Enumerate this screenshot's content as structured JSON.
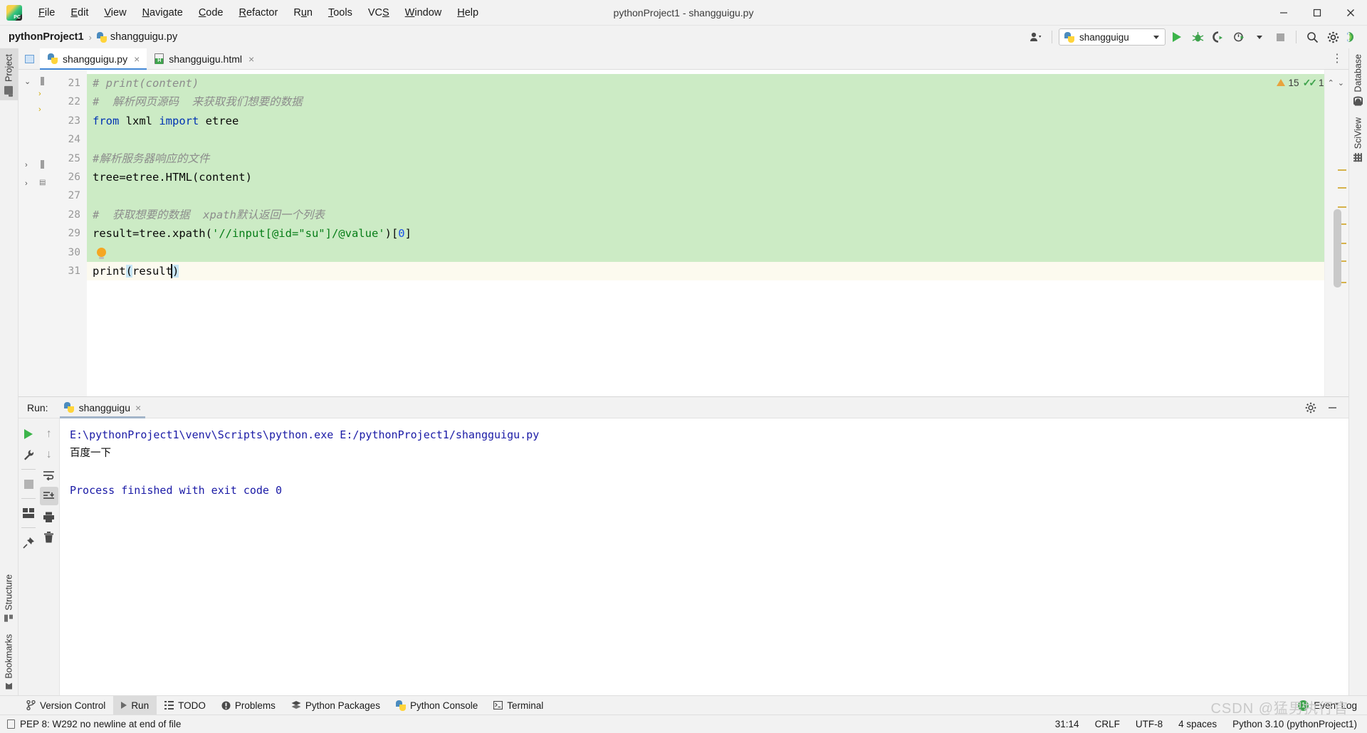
{
  "window": {
    "title": "pythonProject1 - shangguigu.py",
    "controls": {
      "minimize": "—",
      "maximize": "▢",
      "close": "✕"
    }
  },
  "menubar": [
    {
      "label": "File"
    },
    {
      "label": "Edit"
    },
    {
      "label": "View"
    },
    {
      "label": "Navigate"
    },
    {
      "label": "Code"
    },
    {
      "label": "Refactor"
    },
    {
      "label": "Run"
    },
    {
      "label": "Tools"
    },
    {
      "label": "VCS"
    },
    {
      "label": "Window"
    },
    {
      "label": "Help"
    }
  ],
  "breadcrumb": {
    "project": "pythonProject1",
    "separator": "›",
    "file": "shangguigu.py"
  },
  "toolbar": {
    "run_config": "shangguigu",
    "icons": [
      "user-account-icon",
      "run-icon",
      "debug-icon",
      "run-coverage-icon",
      "profile-icon",
      "stop-icon",
      "search-icon",
      "settings-icon",
      "updates-icon"
    ]
  },
  "left_strip": {
    "top": [
      {
        "label": "Project",
        "icon": "folder-icon",
        "active": true
      }
    ],
    "bottom": [
      {
        "label": "Structure",
        "icon": "structure-icon"
      },
      {
        "label": "Bookmarks",
        "icon": "bookmark-icon"
      }
    ]
  },
  "right_strip": [
    {
      "label": "Database",
      "icon": "database-icon"
    },
    {
      "label": "SciView",
      "icon": "grid-icon"
    }
  ],
  "editor": {
    "tabs": [
      {
        "label": "shangguigu.py",
        "icon": "python-file-icon",
        "active": true,
        "close": "×"
      },
      {
        "label": "shangguigu.html",
        "icon": "html-file-icon",
        "active": false,
        "close": "×"
      }
    ],
    "inspection": {
      "warning_count": "15",
      "check_count": "1",
      "up": "⌃",
      "down": "⌄"
    },
    "lines": [
      {
        "num": "21",
        "tokens": [
          {
            "t": "# print(content)",
            "c": "cm"
          }
        ],
        "hl": "green"
      },
      {
        "num": "22",
        "tokens": [
          {
            "t": "#  解析网页源码  来获取我们想要的数据",
            "c": "cm"
          }
        ],
        "hl": "green"
      },
      {
        "num": "23",
        "tokens": [
          {
            "t": "from",
            "c": "kw"
          },
          {
            "t": " lxml ",
            "c": "plain"
          },
          {
            "t": "import",
            "c": "kw"
          },
          {
            "t": " etree",
            "c": "plain"
          }
        ],
        "hl": "green"
      },
      {
        "num": "24",
        "tokens": [],
        "hl": "green"
      },
      {
        "num": "25",
        "tokens": [
          {
            "t": "#解析服务器响应的文件",
            "c": "cm"
          }
        ],
        "hl": "green"
      },
      {
        "num": "26",
        "tokens": [
          {
            "t": "tree=etree.HTML(content)",
            "c": "plain"
          }
        ],
        "hl": "green"
      },
      {
        "num": "27",
        "tokens": [],
        "hl": "green"
      },
      {
        "num": "28",
        "tokens": [
          {
            "t": "#  获取想要的数据  xpath默认返回一个列表",
            "c": "cm"
          }
        ],
        "hl": "green"
      },
      {
        "num": "29",
        "tokens": [
          {
            "t": "result=tree.xpath(",
            "c": "plain"
          },
          {
            "t": "'//input[@id=\"su\"]/@value'",
            "c": "str"
          },
          {
            "t": ")[",
            "c": "plain"
          },
          {
            "t": "0",
            "c": "num"
          },
          {
            "t": "]",
            "c": "plain"
          }
        ],
        "hl": "green"
      },
      {
        "num": "30",
        "tokens": [],
        "hl": "green",
        "bulb": true
      },
      {
        "num": "31",
        "tokens": [
          {
            "t": "print",
            "c": "plain"
          },
          {
            "t": "(",
            "c": "sel"
          },
          {
            "t": "result",
            "c": "plain"
          },
          {
            "t": ")",
            "c": "sel"
          }
        ],
        "hl": "cur",
        "caret": true
      }
    ]
  },
  "run_panel": {
    "label": "Run:",
    "tab": "shangguigu",
    "tab_close": "×",
    "header_icons": [
      "settings-icon",
      "minimize-icon"
    ],
    "side_buttons_left": [
      "rerun-icon",
      "settings-wrench-icon",
      "stop-icon",
      "layout-icon",
      "pin-icon"
    ],
    "side_buttons_right": [
      "up-arrow-icon",
      "down-arrow-icon",
      "soft-wrap-icon",
      "scroll-to-end-icon",
      "print-icon",
      "trash-icon"
    ],
    "console_lines": [
      {
        "text": "E:\\pythonProject1\\venv\\Scripts\\python.exe E:/pythonProject1/shangguigu.py",
        "style": "path"
      },
      {
        "text": "百度一下",
        "style": "out"
      },
      {
        "text": "",
        "style": "out"
      },
      {
        "text": "Process finished with exit code 0",
        "style": "fin"
      }
    ]
  },
  "toolwindow_bar": {
    "items": [
      {
        "label": "Version Control",
        "icon": "branch-icon",
        "active": false
      },
      {
        "label": "Run",
        "icon": "run-icon",
        "active": true
      },
      {
        "label": "TODO",
        "icon": "list-icon",
        "active": false
      },
      {
        "label": "Problems",
        "icon": "warning-circle-icon",
        "active": false
      },
      {
        "label": "Python Packages",
        "icon": "packages-icon",
        "active": false
      },
      {
        "label": "Python Console",
        "icon": "python-icon",
        "active": false
      },
      {
        "label": "Terminal",
        "icon": "terminal-icon",
        "active": false
      }
    ],
    "event_log": {
      "label": "Event Log",
      "count": "1"
    }
  },
  "statusbar": {
    "message": "PEP 8: W292 no newline at end of file",
    "right": [
      "31:14",
      "CRLF",
      "UTF-8",
      "4 spaces",
      "Python 3.10 (pythonProject1)"
    ]
  },
  "watermark": "CSDN @猛男执行官",
  "colors": {
    "accent": "#4187d6",
    "green_highlight": "#ccebc5",
    "string_green": "#067d17",
    "keyword_blue": "#0033b3",
    "console_blue": "#1a1aa6",
    "warning_orange": "#e8a33d",
    "success_green": "#3fa34d"
  }
}
